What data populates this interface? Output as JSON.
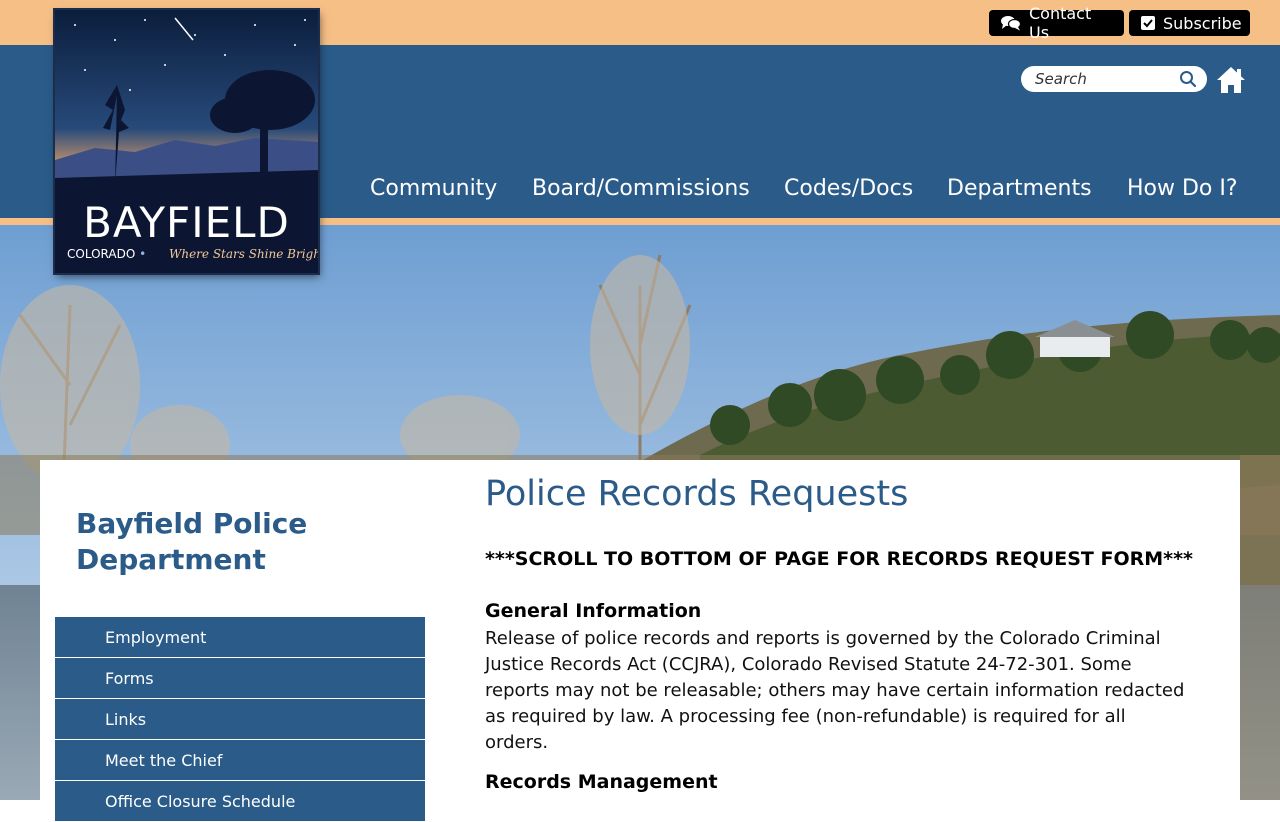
{
  "utility": {
    "contact_label": "Contact Us",
    "subscribe_label": "Subscribe"
  },
  "search": {
    "placeholder": "Search"
  },
  "logo": {
    "title": "BAYFIELD",
    "state": "COLORADO",
    "separator": "•",
    "tagline": "Where Stars Shine Bright"
  },
  "nav": {
    "items": [
      {
        "label": "Community"
      },
      {
        "label": "Board/Commissions"
      },
      {
        "label": "Codes/Docs"
      },
      {
        "label": "Departments"
      },
      {
        "label": "How Do I?"
      }
    ]
  },
  "sidebar": {
    "title": "Bayfield Police Department",
    "items": [
      {
        "label": "Employment"
      },
      {
        "label": "Forms"
      },
      {
        "label": "Links"
      },
      {
        "label": "Meet the Chief"
      },
      {
        "label": "Office Closure Schedule"
      }
    ]
  },
  "main": {
    "title": "Police Records Requests",
    "notice": "***SCROLL TO BOTTOM OF PAGE FOR RECORDS REQUEST FORM***",
    "general_heading": "General Information",
    "general_text": "Release of police records and reports is governed by the Colorado Criminal Justice Records Act (CCJRA), Colorado Revised Statute 24-72-301. Some reports may not be releasable; others may have certain information redacted as required by law.  A processing fee (non-refundable) is required for all orders.",
    "records_heading": "Records Management"
  },
  "colors": {
    "header_blue": "#2a5b89",
    "accent_peach": "#f5bf86",
    "button_black": "#000000"
  },
  "icons": {
    "contact": "chat-bubbles-icon",
    "subscribe": "checkbox-icon",
    "search": "search-icon",
    "home": "home-icon"
  }
}
